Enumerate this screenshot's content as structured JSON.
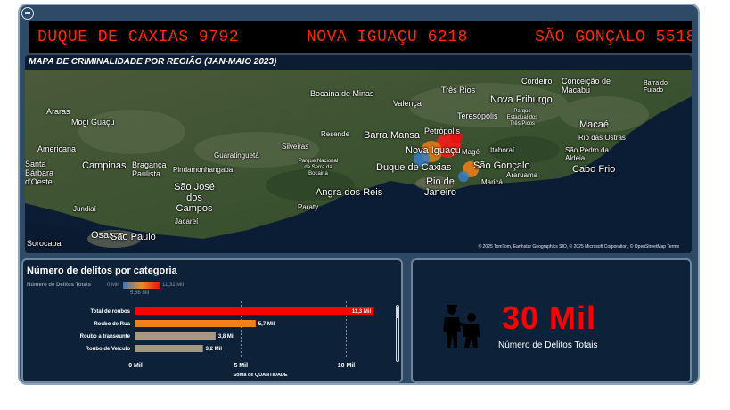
{
  "ticker": {
    "items": [
      "DUQUE DE CAXIAS 9792",
      "NOVA IGUAÇU 6218",
      "SÃO GONÇALO 5518"
    ]
  },
  "map": {
    "title": "MAPA DE CRIMINALIDADE POR REGIÃO (JAN-MAIO 2023)",
    "attribution": "© 2025 TomTom, Earthstar Geographics SIO, © 2025 Microsoft Corporation, © OpenStreetMap  Terms",
    "provider_logo": "bing",
    "labels": [
      "Bocaina de Minas",
      "Valença",
      "Três Rios",
      "Cordeiro",
      "Conceição de Macabu",
      "Barra do Furado",
      "Araras",
      "Mogi Guaçu",
      "Teresópolis",
      "Nova Friburgo",
      "Parque Estadual dos Três Picos",
      "Macaé",
      "Rio das Ostras",
      "Americana",
      "Resende",
      "Barra Mansa",
      "Petrópolis",
      "Santa Bárbara d'Oeste",
      "Campinas",
      "Bragança Paulista",
      "Guaratinguetá",
      "Silveiras",
      "Nova Iguaçu",
      "Magé",
      "Itaboraí",
      "São Pedro da Aldeia",
      "Cabo Frio",
      "Pindamonhangaba",
      "Parque Nacional da Serra da Bocaina",
      "Duque de Caxias",
      "São Gonçalo",
      "Araruama",
      "São José dos Campos",
      "Rio de Janeiro",
      "Maricá",
      "Angra dos Reis",
      "Jundiaí",
      "Paraty",
      "Jacareí",
      "Osasco",
      "São Paulo",
      "Sorocaba"
    ]
  },
  "category_panel": {
    "title": "Número de delitos por categoria",
    "legend_label": "Número de Delitos Totais",
    "legend_min": "0 Mil",
    "legend_max": "11,32 Mil",
    "legend_mid": "5,66 Mil",
    "xlabel": "Soma de QUANTIDADE"
  },
  "chart_data": {
    "type": "bar",
    "orientation": "horizontal",
    "categories": [
      "Total de roubos",
      "Roubo de Rua",
      "Roubo a transeunte",
      "Roubo de Veículo"
    ],
    "values": [
      11.3,
      5.7,
      3.8,
      3.2
    ],
    "value_labels": [
      "11,3 Mil",
      "5,7 Mil",
      "3,8 Mil",
      "3,2 Mil"
    ],
    "colors": [
      "#ff0000",
      "#f28018",
      "#ab9681",
      "#a39885"
    ],
    "xticks": [
      "0 Mil",
      "5 Mil",
      "10 Mil"
    ],
    "xtick_values": [
      0,
      5,
      10
    ],
    "xlim": [
      0,
      11.5
    ],
    "xlabel": "Soma de QUANTIDADE",
    "grid": true
  },
  "kpi": {
    "value": "30 Mil",
    "label": "Número de Delitos Totais",
    "icon": "police-arrest-icon"
  }
}
